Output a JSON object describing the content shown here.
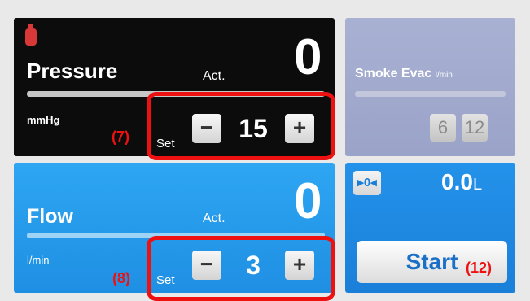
{
  "pressure": {
    "title": "Pressure",
    "act_label": "Act.",
    "act_value": "0",
    "unit": "mmHg",
    "set_label": "Set",
    "set_value": "15",
    "minus": "−",
    "plus": "+",
    "icon": "gas-bottle-icon",
    "annotation": "(7)"
  },
  "flow": {
    "title": "Flow",
    "act_label": "Act.",
    "act_value": "0",
    "unit": "l/min",
    "set_label": "Set",
    "set_value": "3",
    "minus": "−",
    "plus": "+",
    "annotation": "(8)"
  },
  "smoke_evac": {
    "title": "Smoke Evac",
    "unit": "l/min",
    "presets": [
      "6",
      "12"
    ]
  },
  "volume": {
    "reset_label": "▸0◂",
    "value": "0.0",
    "unit": "L",
    "start_label": "Start",
    "annotation": "(12)"
  },
  "colors": {
    "pressure_bg": "#0c0c0c",
    "flow_bg": "#1f8fe3",
    "smoke_bg": "#9aa3c8",
    "volume_bg": "#1a7fd8",
    "callout": "#ee1111",
    "bottle": "#d83838"
  }
}
